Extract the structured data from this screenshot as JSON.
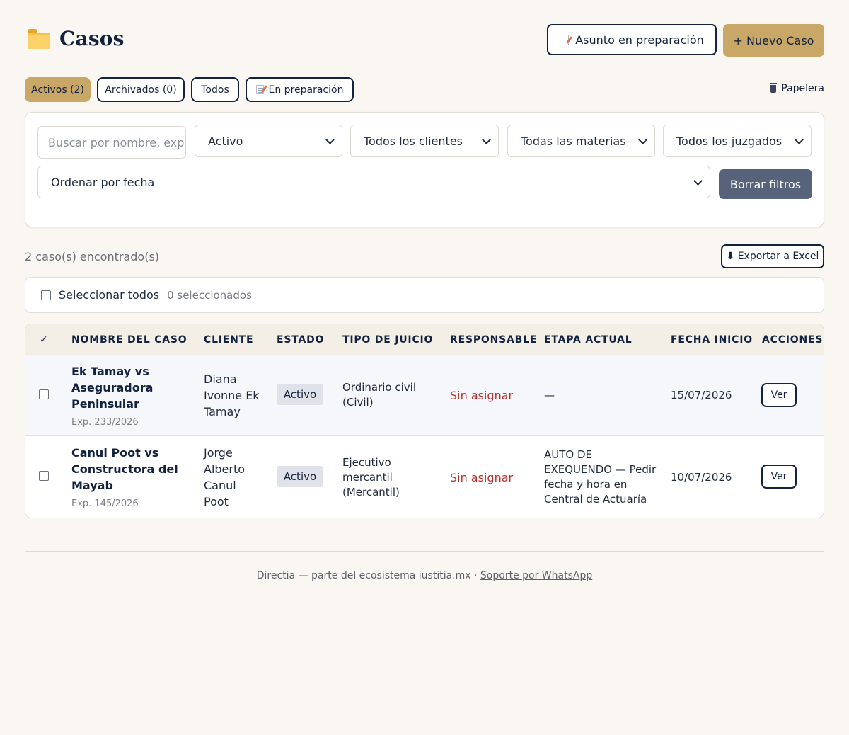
{
  "header": {
    "title": "Casos",
    "folder_icon": "folder-icon",
    "prep_button_label": "Asunto en preparación",
    "new_case_label": "+ Nuevo Caso"
  },
  "tabs": [
    {
      "label": "Activos (2)",
      "active": true
    },
    {
      "label": "Archivados (0)",
      "active": false
    },
    {
      "label": "Todos",
      "active": false
    },
    {
      "label": "En preparación",
      "active": false
    }
  ],
  "trash_label": "Papelera",
  "filters": {
    "search_placeholder": "Buscar por nombre, expediente...",
    "status": "Activo",
    "client": "Todos los clientes",
    "subject": "Todas las materias",
    "court": "Todos los juzgados",
    "sort": "Ordenar por fecha",
    "clear_label": "Borrar filtros"
  },
  "results": {
    "count_text": "2 caso(s) encontrado(s)",
    "export_label": "⬇ Exportar a Excel",
    "select_all_label": "Seleccionar todos",
    "selected_count": "0 seleccionados"
  },
  "table": {
    "headers": [
      "✓",
      "NOMBRE DEL CASO",
      "CLIENTE",
      "ESTADO",
      "TIPO DE JUICIO",
      "RESPONSABLE",
      "ETAPA ACTUAL",
      "FECHA INICIO",
      "ACCIONES"
    ],
    "rows": [
      {
        "name_lines": [
          "Ek Tamay vs",
          "Aseguradora",
          "Peninsular"
        ],
        "exp": "Exp. 233/2026",
        "client_lines": [
          "Diana",
          "Ivonne Ek",
          "Tamay"
        ],
        "status": "Activo",
        "type_lines": [
          "Ordinario civil",
          "(Civil)"
        ],
        "responsible": "Sin asignar",
        "stage_lines": [
          "—"
        ],
        "start_date": "15/07/2026",
        "action": "Ver"
      },
      {
        "name_lines": [
          "Canul Poot vs",
          "Constructora del",
          "Mayab"
        ],
        "exp": "Exp. 145/2026",
        "client_lines": [
          "Jorge",
          "Alberto",
          "Canul",
          "Poot"
        ],
        "status": "Activo",
        "type_lines": [
          "Ejecutivo",
          "mercantil",
          "(Mercantil)"
        ],
        "responsible": "Sin asignar",
        "stage_lines": [
          "AUTO DE",
          "EXEQUENDO — Pedir",
          "fecha y hora en",
          "Central de Actuaría"
        ],
        "start_date": "10/07/2026",
        "action": "Ver"
      }
    ]
  },
  "footer": {
    "text": "Directia — parte del ecosistema iustitia.mx · ",
    "link": "Soporte por WhatsApp"
  },
  "colors": {
    "background": "#faf6f1",
    "navy": "#13233f",
    "gold": "#c9a766",
    "slate": "#56637a",
    "danger": "#b5322b"
  }
}
